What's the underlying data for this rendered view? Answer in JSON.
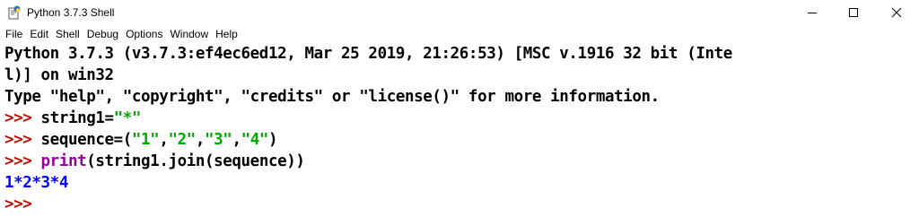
{
  "window": {
    "title": "Python 3.7.3 Shell",
    "icon": "python-idle-icon",
    "controls": [
      "minimize",
      "maximize",
      "close"
    ]
  },
  "menu": {
    "items": [
      "File",
      "Edit",
      "Shell",
      "Debug",
      "Options",
      "Window",
      "Help"
    ]
  },
  "shell": {
    "banner_line1": "Python 3.7.3 (v3.7.3:ef4ec6ed12, Mar 25 2019, 21:26:53) [MSC v.1916 32 bit (Inte",
    "banner_line2": "l)] on win32",
    "banner_line3": "Type \"help\", \"copyright\", \"credits\" or \"license()\" for more information.",
    "prompt": ">>> ",
    "cmd1": {
      "code": "string1=",
      "string": "\"*\""
    },
    "cmd2": {
      "code_start": "sequence=(",
      "s1": "\"1\"",
      "comma1": ",",
      "s2": "\"2\"",
      "comma2": ",",
      "s3": "\"3\"",
      "comma3": ",",
      "s4": "\"4\"",
      "code_end": ")"
    },
    "cmd3": {
      "keyword": "print",
      "code": "(string1.join(sequence))"
    },
    "output": "1*2*3*4"
  },
  "colors": {
    "prompt": "#b11100",
    "string": "#00aa00",
    "builtin": "#990099",
    "output": "#0000ff",
    "text": "#000000"
  }
}
